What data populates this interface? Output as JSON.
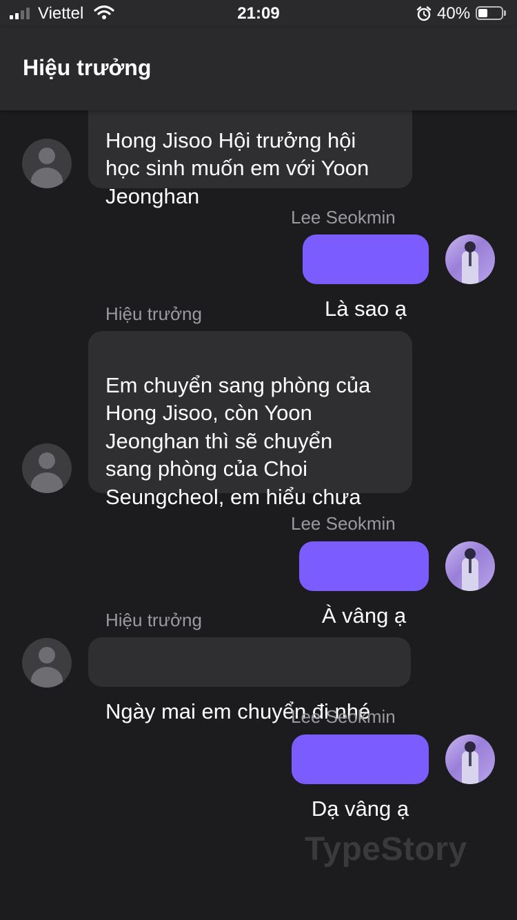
{
  "status_bar": {
    "carrier": "Viettel",
    "time": "21:09",
    "battery_percent": "40%",
    "battery_level": 0.4,
    "icons": [
      "signal-icon",
      "wifi-icon",
      "alarm-icon",
      "battery-icon"
    ]
  },
  "header": {
    "title": "Hiệu trưởng"
  },
  "messages": [
    {
      "direction": "incoming",
      "text": "Hong Jisoo Hội trưởng hội\nhọc sinh muốn em với Yoon\nJeonghan"
    },
    {
      "direction": "outgoing",
      "sender": "Lee Seokmin",
      "text": "Là sao ạ"
    },
    {
      "direction": "incoming",
      "sender": "Hiệu trưởng",
      "text": "Em chuyển sang phòng của\nHong Jisoo, còn Yoon\nJeonghan thì sẽ chuyển\nsang phòng của Choi\nSeungcheol, em hiểu chưa"
    },
    {
      "direction": "outgoing",
      "sender": "Lee Seokmin",
      "text": "À vâng ạ"
    },
    {
      "direction": "incoming",
      "sender": "Hiệu trưởng",
      "text": "Ngày mai em chuyển đi nhé"
    },
    {
      "direction": "outgoing",
      "sender": "Lee Seokmin",
      "text": "Dạ vâng ạ"
    }
  ],
  "watermark": "TypeStory",
  "colors": {
    "background": "#1c1c1e",
    "header": "#2a2a2c",
    "incoming_bubble": "#2f2f31",
    "outgoing_bubble": "#7b5cff",
    "sender_text": "#9b9b9f"
  }
}
